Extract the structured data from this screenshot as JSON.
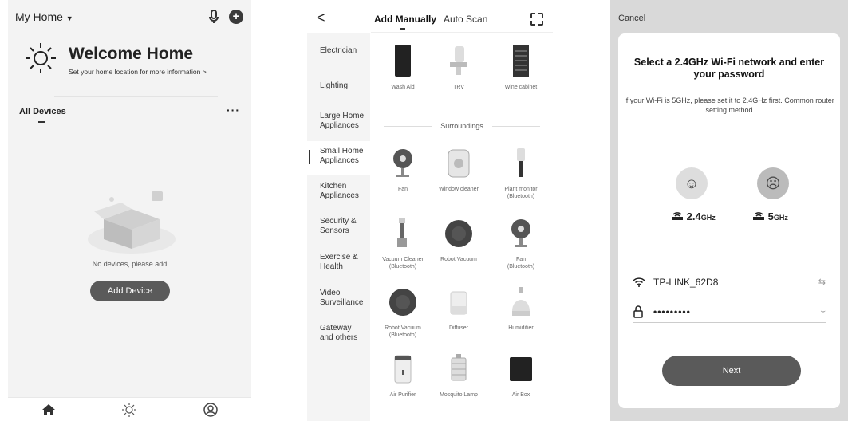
{
  "home": {
    "home_name": "My Home",
    "welcome": "Welcome Home",
    "location_hint": "Set your home location for more information >",
    "all_devices": "All Devices",
    "more": "···",
    "empty_text": "No devices, please add",
    "add_device": "Add Device"
  },
  "add": {
    "back": "<",
    "tab_manual": "Add Manually",
    "tab_scan": "Auto Scan",
    "categories": [
      "Electrician",
      "Lighting",
      "Large Home\nAppliances",
      "Small Home\nAppliances",
      "Kitchen\nAppliances",
      "Security &\nSensors",
      "Exercise &\nHealth",
      "Video\nSurveillance",
      "Gateway\nand others"
    ],
    "top_items": [
      "Wash Aid",
      "TRV",
      "Wine cabinet"
    ],
    "section_title": "Surroundings",
    "items": [
      "Fan",
      "Window cleaner",
      "Plant monitor\n(Bluetooth)",
      "Vacuum Cleaner\n(Bluetooth)",
      "Robot Vacuum",
      "Fan\n(Bluetooth)",
      "Robot Vacuum\n(Bluetooth)",
      "Diffuser",
      "Humidifier",
      "Air Purifier",
      "Mosquito Lamp",
      "Air Box"
    ]
  },
  "wifi": {
    "cancel": "Cancel",
    "title": "Select a 2.4GHz Wi-Fi network and enter your password",
    "hint": "If your Wi-Fi is 5GHz, please set it to 2.4GHz first. Common router setting method",
    "band_24": "2.4",
    "band_5": "5",
    "band_unit": "GHz",
    "ssid": "TP-LINK_62D8",
    "password": "•••••••••",
    "next": "Next"
  }
}
